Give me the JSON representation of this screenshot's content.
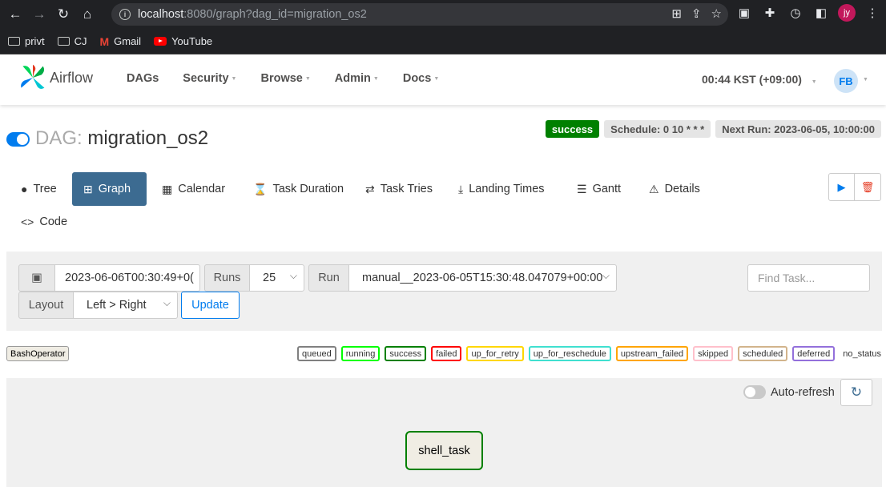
{
  "browser": {
    "url_host": "localhost",
    "url_rest": ":8080/graph?dag_id=migration_os2",
    "bookmarks": [
      "privt",
      "CJ",
      "Gmail",
      "YouTube"
    ],
    "profile_initials": "jy"
  },
  "navbar": {
    "brand": "Airflow",
    "menu": [
      "DAGs",
      "Security",
      "Browse",
      "Admin",
      "Docs"
    ],
    "clock": "00:44 KST (+09:00)",
    "user_initials": "FB"
  },
  "dag": {
    "prefix": "DAG:",
    "name": "migration_os2",
    "status": "success",
    "schedule": "Schedule: 0 10 * * *",
    "next_run": "Next Run: 2023-06-05, 10:00:00"
  },
  "tabs": [
    "Tree",
    "Graph",
    "Calendar",
    "Task Duration",
    "Task Tries",
    "Landing Times",
    "Gantt",
    "Details",
    "Code"
  ],
  "active_tab": "Graph",
  "controls": {
    "base_date": "2023-06-06T00:30:49+0(",
    "runs_label": "Runs",
    "runs_value": "25",
    "run_label": "Run",
    "run_value": "manual__2023-06-05T15:30:48.047079+00:00",
    "find_placeholder": "Find Task...",
    "layout_label": "Layout",
    "layout_value": "Left > Right",
    "update_label": "Update"
  },
  "legend": {
    "operator": "BashOperator",
    "states": [
      {
        "label": "queued",
        "color": "#808080"
      },
      {
        "label": "running",
        "color": "#00ff00"
      },
      {
        "label": "success",
        "color": "#008000"
      },
      {
        "label": "failed",
        "color": "#ff0000"
      },
      {
        "label": "up_for_retry",
        "color": "#ffd700"
      },
      {
        "label": "up_for_reschedule",
        "color": "#40e0d0"
      },
      {
        "label": "upstream_failed",
        "color": "#ffa500"
      },
      {
        "label": "skipped",
        "color": "#ffc0cb"
      },
      {
        "label": "scheduled",
        "color": "#d2b48c"
      },
      {
        "label": "deferred",
        "color": "#9370db"
      },
      {
        "label": "no_status",
        "color": "#ffffff"
      }
    ]
  },
  "graph": {
    "autorefresh_label": "Auto-refresh",
    "task": "shell_task"
  }
}
